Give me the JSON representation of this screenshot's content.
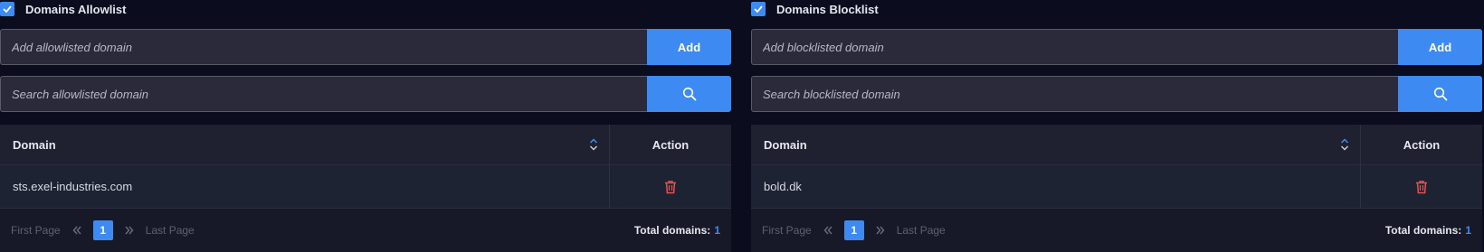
{
  "colors": {
    "accent": "#3d8bf2",
    "danger": "#e25252",
    "background": "#0b0c1e",
    "input_background": "#2a2a3a"
  },
  "allowlist": {
    "checked": true,
    "title": "Domains Allowlist",
    "add_placeholder": "Add allowlisted domain",
    "add_button": "Add",
    "search_placeholder": "Search allowlisted domain",
    "search_icon": "search-icon",
    "columns": [
      "Domain",
      "Action"
    ],
    "rows": [
      {
        "domain": "sts.exel-industries.com",
        "action_icon": "trash-icon"
      }
    ],
    "pagination": {
      "first": "First Page",
      "last": "Last Page",
      "current_page": "1",
      "total_label": "Total domains:",
      "total_count": "1"
    }
  },
  "blocklist": {
    "checked": true,
    "title": "Domains Blocklist",
    "add_placeholder": "Add blocklisted domain",
    "add_button": "Add",
    "search_placeholder": "Search blocklisted domain",
    "search_icon": "search-icon",
    "columns": [
      "Domain",
      "Action"
    ],
    "rows": [
      {
        "domain": "bold.dk",
        "action_icon": "trash-icon"
      }
    ],
    "pagination": {
      "first": "First Page",
      "last": "Last Page",
      "current_page": "1",
      "total_label": "Total domains:",
      "total_count": "1"
    }
  }
}
